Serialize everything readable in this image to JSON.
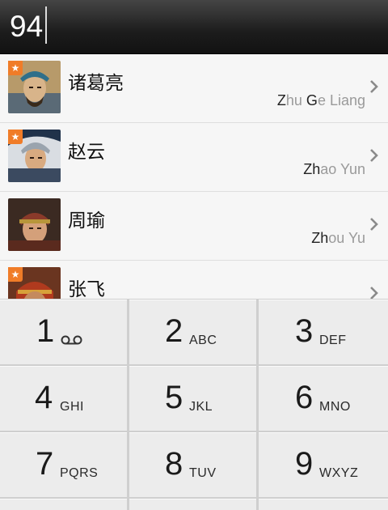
{
  "dial": {
    "value": "94"
  },
  "contacts": [
    {
      "name": "诸葛亮",
      "pinyin_parts": [
        {
          "t": "Z",
          "hl": true
        },
        {
          "t": "hu ",
          "hl": false
        },
        {
          "t": "G",
          "hl": true
        },
        {
          "t": "e Liang",
          "hl": false
        }
      ],
      "favorite": true,
      "avatar": "avatar-zhuge"
    },
    {
      "name": "赵云",
      "pinyin_parts": [
        {
          "t": "Zh",
          "hl": true
        },
        {
          "t": "ao Yun",
          "hl": false
        }
      ],
      "favorite": true,
      "avatar": "avatar-zhao"
    },
    {
      "name": "周瑜",
      "pinyin_parts": [
        {
          "t": "Zh",
          "hl": true
        },
        {
          "t": "ou Yu",
          "hl": false
        }
      ],
      "favorite": false,
      "avatar": "avatar-zhou"
    },
    {
      "name": "张飞",
      "pinyin_parts": [],
      "favorite": true,
      "avatar": "avatar-zhang"
    }
  ],
  "keypad": [
    {
      "digit": "1",
      "letters": "",
      "icon": "voicemail-icon"
    },
    {
      "digit": "2",
      "letters": "ABC"
    },
    {
      "digit": "3",
      "letters": "DEF"
    },
    {
      "digit": "4",
      "letters": "GHI"
    },
    {
      "digit": "5",
      "letters": "JKL"
    },
    {
      "digit": "6",
      "letters": "MNO"
    },
    {
      "digit": "7",
      "letters": "PQRS"
    },
    {
      "digit": "8",
      "letters": "TUV"
    },
    {
      "digit": "9",
      "letters": "WXYZ"
    }
  ],
  "colors": {
    "favorite_badge": "#f07c28",
    "top_bar": "#1c1c1c",
    "pinyin_match": "#222222",
    "pinyin_rest": "#9a9a9a"
  },
  "icons": {
    "favorite": "star-icon",
    "row_chevron": "chevron-right-icon"
  }
}
